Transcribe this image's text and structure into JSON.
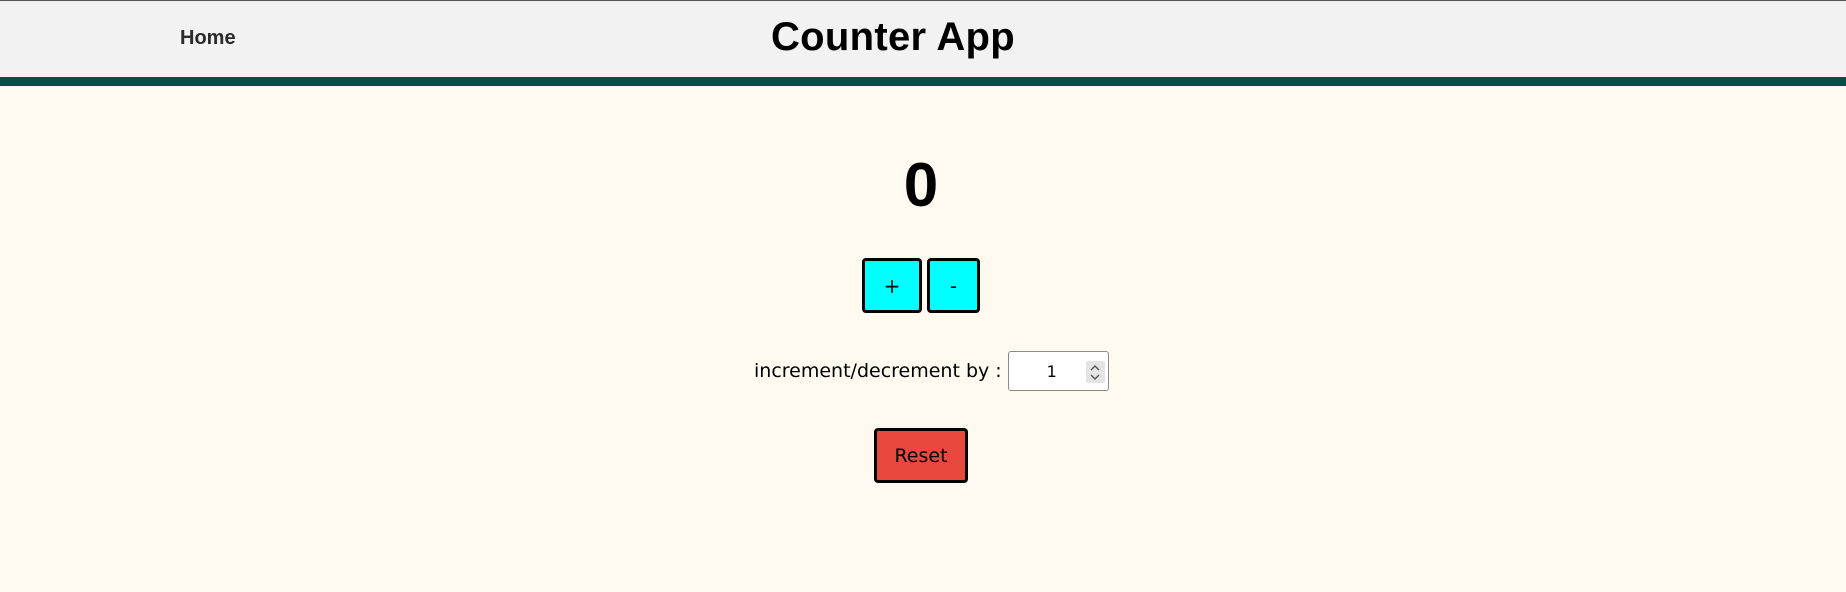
{
  "header": {
    "nav_home_label": "Home",
    "title": "Counter App"
  },
  "counter": {
    "value": "0",
    "increment_label": "+",
    "decrement_label": "-"
  },
  "step": {
    "label": "increment/decrement by :",
    "value": "1"
  },
  "reset": {
    "label": "Reset"
  },
  "colors": {
    "page_background": "#fffaf0",
    "header_background": "#f2f2f2",
    "header_accent": "#0c4a45",
    "step_button": "#00ffff",
    "reset_button": "#e8483d"
  },
  "icons": {
    "spinner_up": "chevron-up-icon",
    "spinner_down": "chevron-down-icon"
  }
}
